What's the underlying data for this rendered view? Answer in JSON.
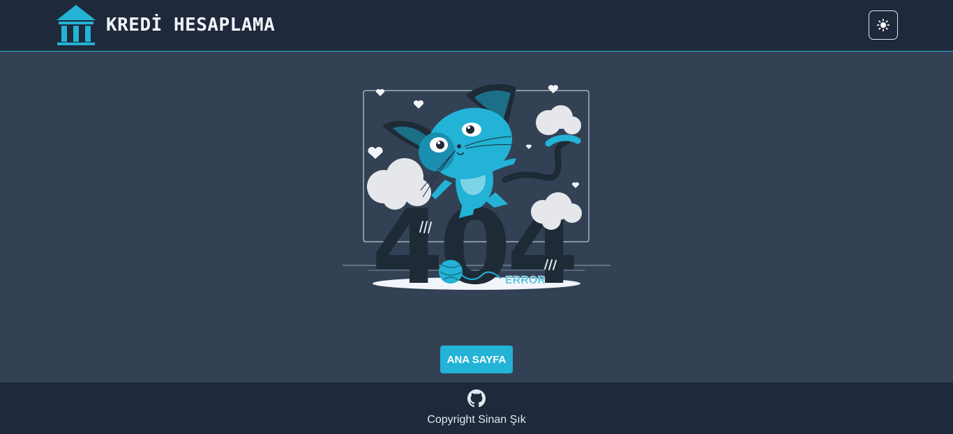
{
  "header": {
    "title": "KREDİ HESAPLAMA",
    "logo_icon": "bank-icon",
    "theme_toggle_icon": "sun-icon"
  },
  "illustration": {
    "big_text": "404",
    "error_text": "ERROR"
  },
  "main": {
    "home_button_label": "ANA SAYFA"
  },
  "footer": {
    "github_icon": "github-icon",
    "copyright": "Copyright Sinan Şık"
  },
  "colors": {
    "accent": "#22b3d6",
    "header_bg": "#1e293b",
    "page_bg": "#334155"
  }
}
